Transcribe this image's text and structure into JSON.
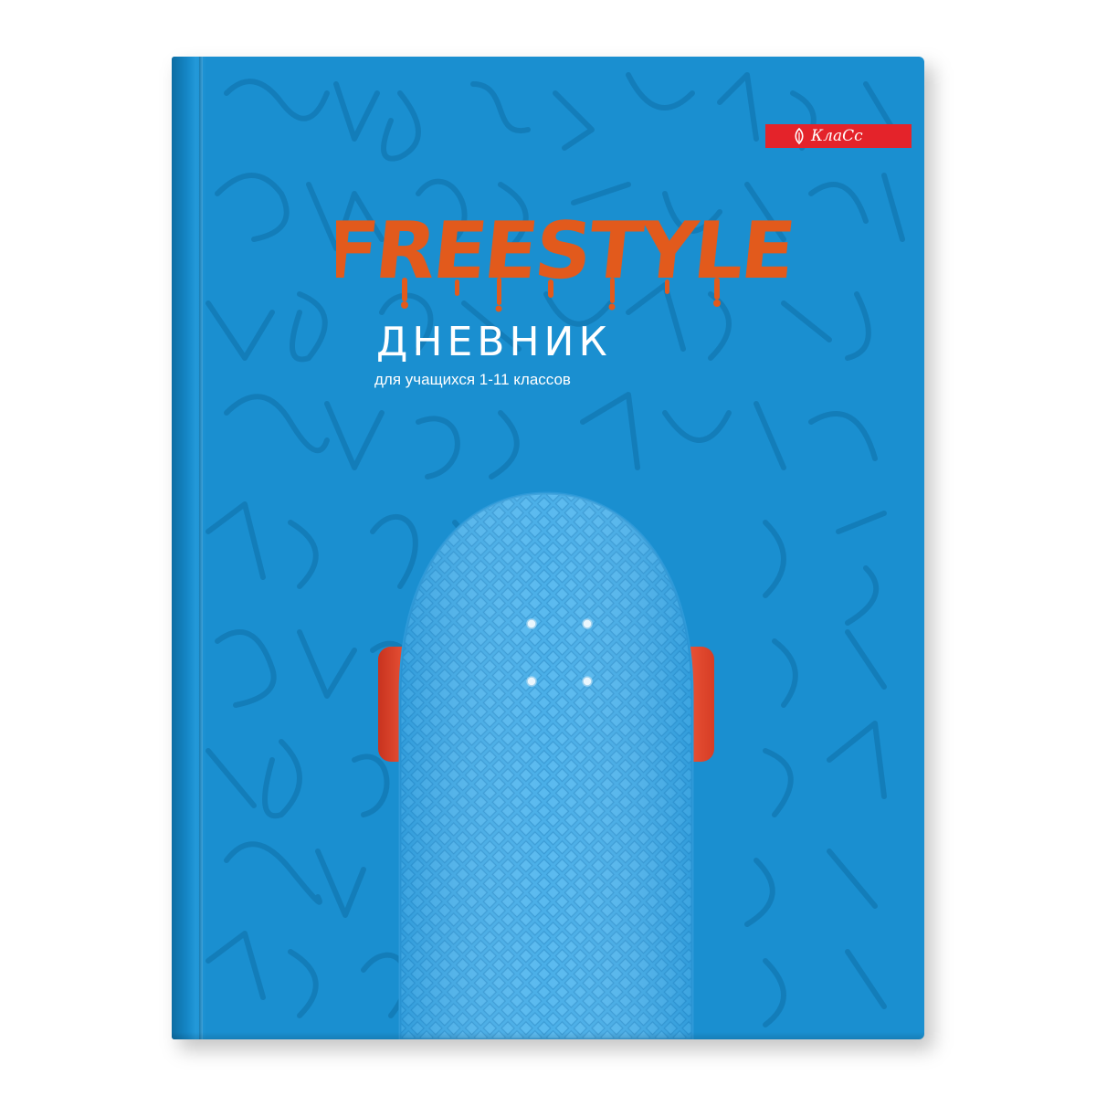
{
  "cover": {
    "brand": {
      "name": "КлаСс"
    },
    "title_logo": "FREESTYLE",
    "title": "ДНЕВНИК",
    "subtitle": "для учащихся 1-11 классов"
  },
  "colors": {
    "cover_blue": "#1a8fd0",
    "pattern_blue": "#0f6fa8",
    "logo_orange": "#e25a1c",
    "brand_red": "#e4232a",
    "deck_blue": "#3aa8e6",
    "wheel_red": "#e8442a"
  },
  "icons": [
    "brand-leaf-icon"
  ]
}
